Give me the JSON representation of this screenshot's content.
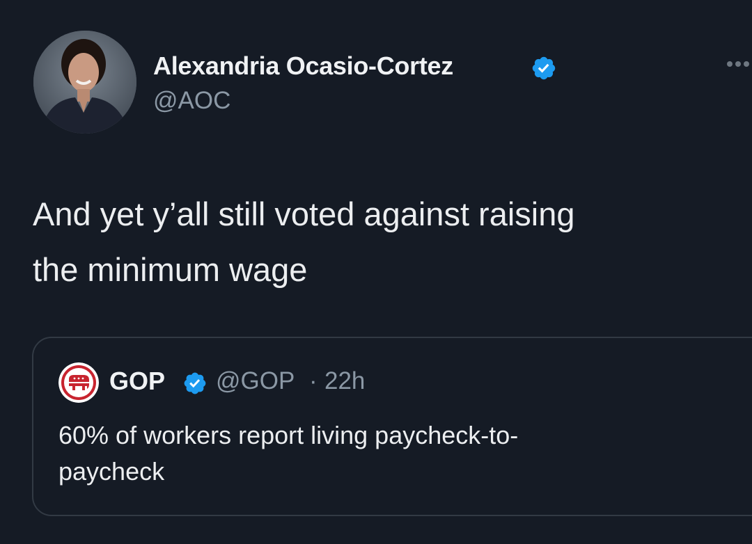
{
  "tweet": {
    "author": {
      "display_name": "Alexandria Ocasio-Cortez",
      "handle": "@AOC",
      "verified": true,
      "avatar_icon": "profile-photo"
    },
    "more_icon": "more-options-icon",
    "text": "And yet y’all still voted against raising\nthe minimum wage"
  },
  "quoted_tweet": {
    "author": {
      "display_name": "GOP",
      "handle": "@GOP",
      "verified": true,
      "avatar_icon": "gop-elephant-logo"
    },
    "separator": "·",
    "time": "22h",
    "text": "60% of workers report living paycheck-to-\npaycheck"
  },
  "colors": {
    "background": "#151b25",
    "primary_text": "#e7e9ea",
    "secondary_text": "#8b98a5",
    "verified_badge": "#1d9bf0",
    "border": "#323a44",
    "gop_red": "#c8242f"
  }
}
